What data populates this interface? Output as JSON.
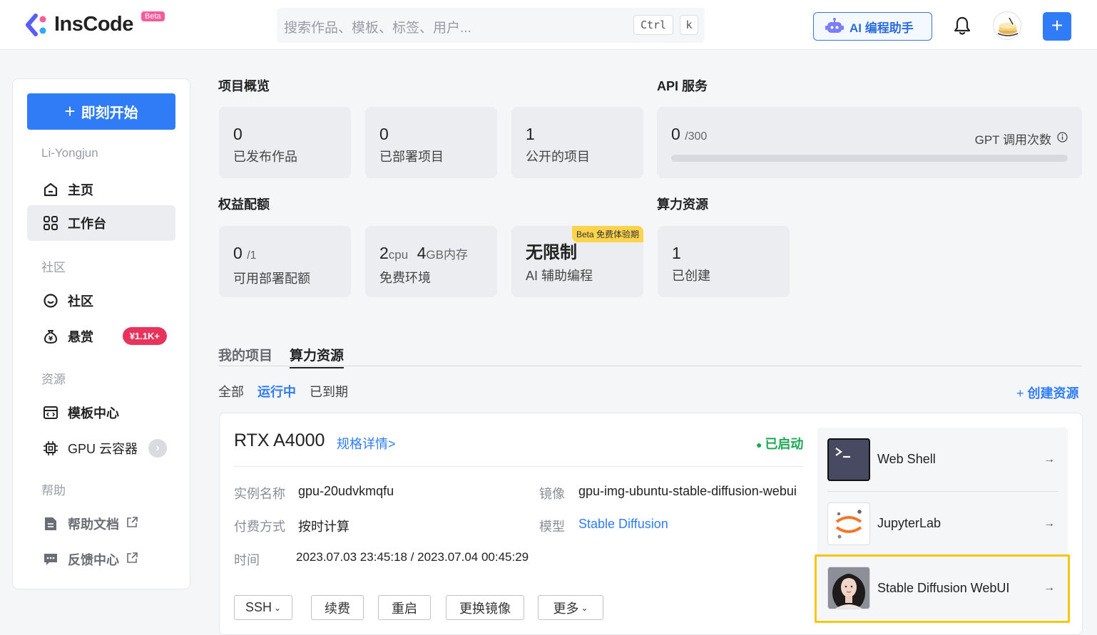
{
  "header": {
    "logo_text": "InsCode",
    "logo_badge": "Beta",
    "search_placeholder": "搜索作品、模板、标签、用户...",
    "kbd_ctrl": "Ctrl",
    "kbd_k": "k",
    "ai_button_label": "AI 编程助手",
    "plus_label": "+"
  },
  "sidebar": {
    "start_button": "即刻开始",
    "username": "Li-Yongjun",
    "items": [
      {
        "label": "主页"
      },
      {
        "label": "工作台"
      },
      {
        "label": "社区"
      },
      {
        "label": "悬赏",
        "badge": "¥1.1K+"
      },
      {
        "label": "模板中心"
      },
      {
        "label": "GPU 云容器"
      },
      {
        "label": "帮助文档"
      },
      {
        "label": "反馈中心"
      }
    ],
    "groups": {
      "community": "社区",
      "resources": "资源",
      "help": "帮助"
    }
  },
  "overview": {
    "title": "项目概览",
    "cards": [
      {
        "num": "0",
        "label": "已发布作品"
      },
      {
        "num": "0",
        "label": "已部署项目"
      },
      {
        "num": "1",
        "label": "公开的项目"
      }
    ]
  },
  "api": {
    "title": "API 服务",
    "used": "0",
    "total": "/300",
    "label": "GPT 调用次数",
    "progress": 0
  },
  "quota": {
    "title": "权益配额",
    "cards": [
      {
        "num": "0",
        "suffix": "/1",
        "label": "可用部署配额"
      },
      {
        "cpu_num": "2",
        "cpu_unit": "cpu",
        "mem_num": "4",
        "mem_unit": "GB内存",
        "label": "免费环境"
      },
      {
        "num": "无限制",
        "label": "AI 辅助编程",
        "tag": "Beta 免费体验期"
      }
    ]
  },
  "compute": {
    "title": "算力资源",
    "num": "1",
    "label": "已创建"
  },
  "tabs": [
    "我的项目",
    "算力资源"
  ],
  "filters": [
    "全部",
    "运行中",
    "已到期"
  ],
  "create_resource": "创建资源",
  "resource": {
    "name": "RTX A4000",
    "spec_link": "规格详情>",
    "status": "已启动",
    "instance_key": "实例名称",
    "instance_val": "gpu-20udvkmqfu",
    "image_key": "镜像",
    "image_val": "gpu-img-ubuntu-stable-diffusion-webui",
    "pay_key": "付费方式",
    "pay_val": "按时计算",
    "model_key": "模型",
    "model_val": "Stable Diffusion",
    "time_key": "时间",
    "time_val": "2023.07.03 23:45:18 / 2023.07.04 00:45:29",
    "buttons": [
      "SSH",
      "续费",
      "重启",
      "更换镜像",
      "更多"
    ]
  },
  "tools": [
    {
      "name": "Web Shell",
      "icon": "terminal-icon"
    },
    {
      "name": "JupyterLab",
      "icon": "jupyter-icon"
    },
    {
      "name": "Stable Diffusion WebUI",
      "icon": "portrait-icon"
    }
  ]
}
